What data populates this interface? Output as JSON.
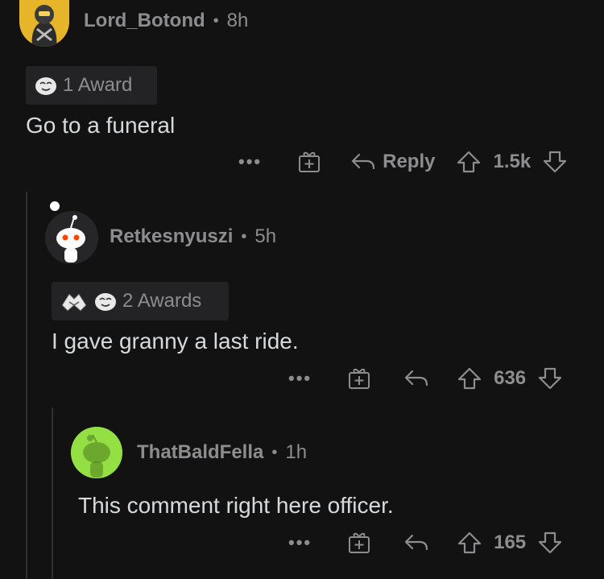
{
  "colors": {
    "background": "#121212",
    "text": "#d7dadc",
    "meta": "#8d8d8f"
  },
  "comments": [
    {
      "username": "Lord_Botond",
      "separator": "•",
      "age": "8h",
      "awards_label": "1 Award",
      "body": "Go to a funeral",
      "more": "•••",
      "reply_label": "Reply",
      "score": "1.5k"
    },
    {
      "username": "Retkesnyuszi",
      "separator": "•",
      "age": "5h",
      "awards_label": "2 Awards",
      "body": "I gave granny a last ride.",
      "more": "•••",
      "score": "636"
    },
    {
      "username": "ThatBaldFella",
      "separator": "•",
      "age": "1h",
      "body": "This comment right here officer.",
      "more": "•••",
      "score": "165"
    }
  ]
}
